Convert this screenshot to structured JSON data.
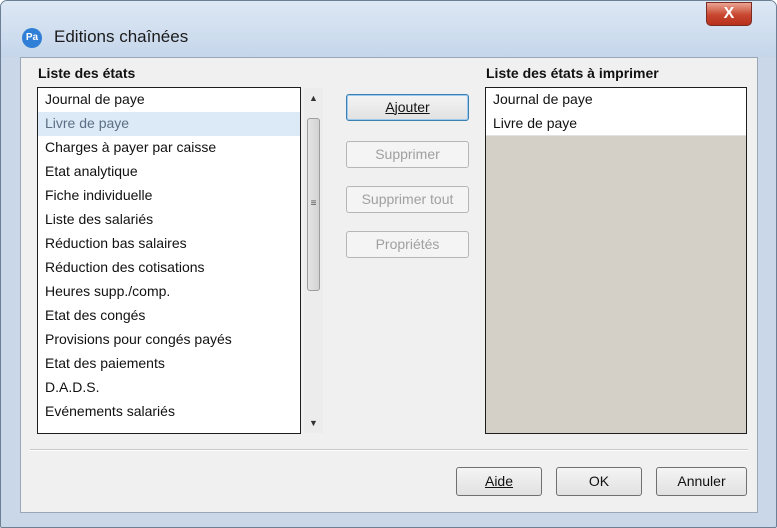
{
  "window": {
    "title": "Editions chaînées",
    "app_icon": "Pa",
    "close_glyph": "X"
  },
  "left": {
    "label": "Liste des états",
    "items": [
      "Journal de paye",
      "Livre de paye",
      "Charges à payer par caisse",
      "Etat analytique",
      "Fiche individuelle",
      "Liste des salariés",
      "Réduction bas salaires",
      "Réduction des cotisations",
      "Heures supp./comp.",
      "Etat des congés",
      "Provisions pour congés payés",
      "Etat des paiements",
      "D.A.D.S.",
      "Evénements salariés"
    ],
    "selected_index": 1
  },
  "right": {
    "label": "Liste des états à imprimer",
    "items": [
      "Journal de paye",
      "Livre de paye"
    ]
  },
  "buttons": {
    "ajouter": "Ajouter",
    "supprimer": "Supprimer",
    "supprimer_tout": "Supprimer tout",
    "proprietes": "Propriétés",
    "aide": "Aide",
    "ok": "OK",
    "annuler": "Annuler"
  },
  "scrollbar": {
    "up": "▲",
    "down": "▼",
    "grip": "≡"
  }
}
